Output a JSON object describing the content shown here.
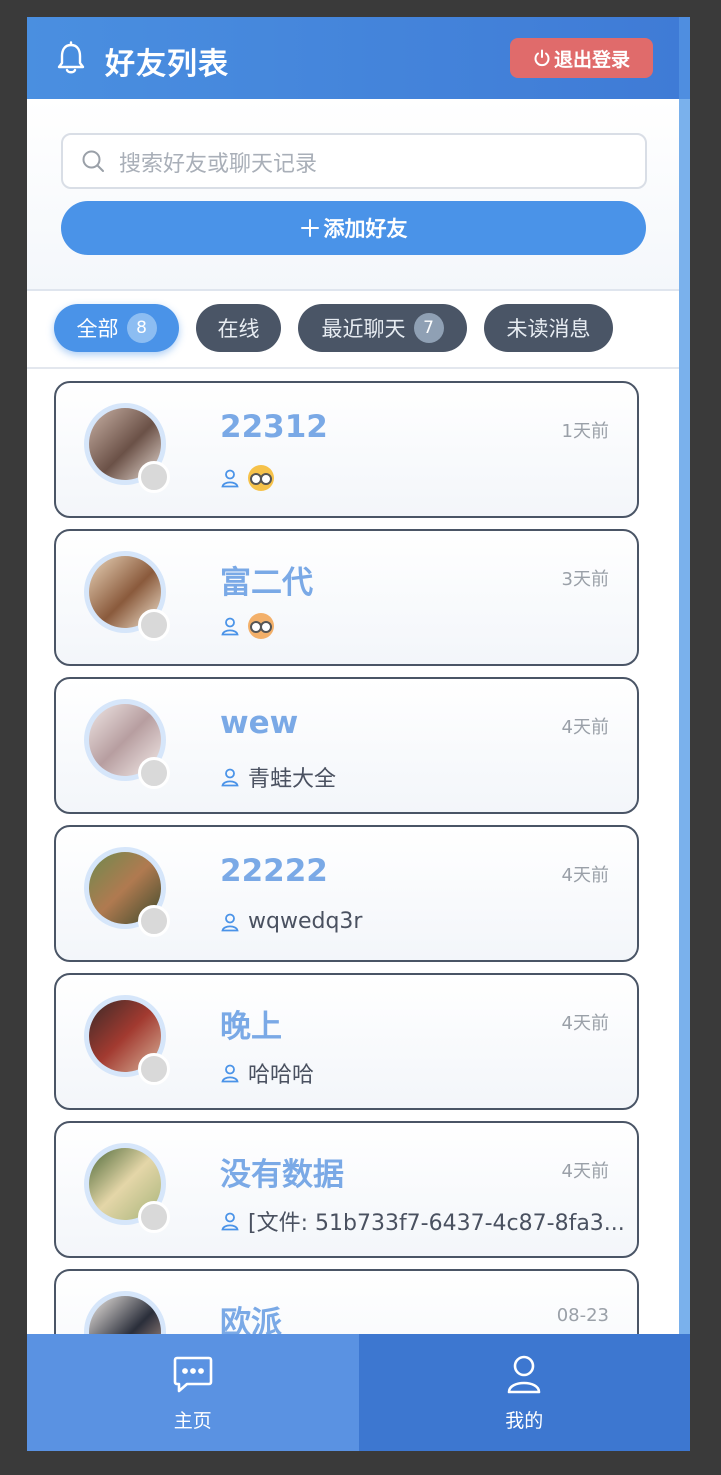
{
  "header": {
    "title": "好友列表",
    "logout_label": "退出登录",
    "bell_icon": "bell-icon",
    "power_icon": "power-icon"
  },
  "search": {
    "placeholder": "搜索好友或聊天记录",
    "add_friend_label": "添加好友"
  },
  "tabs": [
    {
      "label": "全部",
      "badge": "8",
      "active": true
    },
    {
      "label": "在线",
      "badge": null,
      "active": false
    },
    {
      "label": "最近聊天",
      "badge": "7",
      "active": false
    },
    {
      "label": "未读消息",
      "badge": null,
      "active": false
    }
  ],
  "friends": [
    {
      "name": "22312",
      "time": "1天前",
      "message": "",
      "emoji": true
    },
    {
      "name": "富二代",
      "time": "3天前",
      "message": "",
      "emoji": true
    },
    {
      "name": "wew",
      "time": "4天前",
      "message": "青蛙大全",
      "emoji": false
    },
    {
      "name": "22222",
      "time": "4天前",
      "message": "wqwedq3r",
      "emoji": false
    },
    {
      "name": "晚上",
      "time": "4天前",
      "message": "哈哈哈",
      "emoji": false
    },
    {
      "name": "没有数据",
      "time": "4天前",
      "message": "[文件: 51b733f7-6437-4c87-8fa3...",
      "emoji": false
    },
    {
      "name": "欧派",
      "time": "08-23",
      "message": "",
      "emoji": false
    }
  ],
  "nav": {
    "home_label": "主页",
    "mine_label": "我的"
  },
  "colors": {
    "primary": "#4a93e8",
    "header": "#4a8fe0",
    "logout": "#e06b6b",
    "tab_inactive": "#4a5566",
    "name": "#7aa9e6"
  }
}
